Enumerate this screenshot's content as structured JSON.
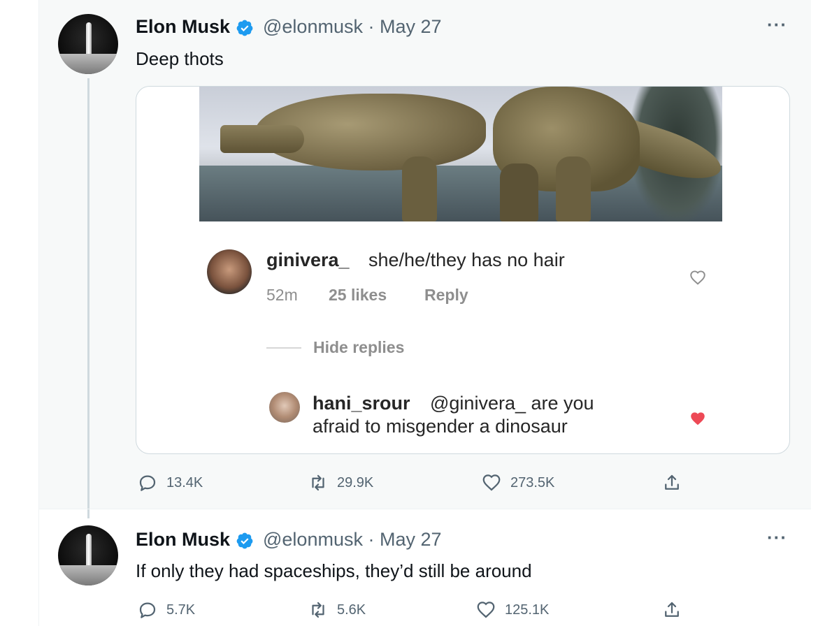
{
  "tweets": [
    {
      "name": "Elon Musk",
      "handle": "@elonmusk · May 27",
      "text": "Deep thots",
      "more": "···",
      "media": {
        "comment1": {
          "user": "ginivera_",
          "text": "she/he/they has no hair",
          "time": "52m",
          "likes": "25 likes",
          "reply": "Reply"
        },
        "hide_replies": "Hide replies",
        "comment2": {
          "user": "hani_srour",
          "text_line1": "@ginivera_ are you",
          "text_line2": "afraid to misgender a dinosaur"
        }
      },
      "actions": {
        "replies": "13.4K",
        "retweets": "29.9K",
        "likes": "273.5K"
      }
    },
    {
      "name": "Elon Musk",
      "handle": "@elonmusk · May 27",
      "text": "If only they had spaceships, they’d still be around",
      "more": "···",
      "actions": {
        "replies": "5.7K",
        "retweets": "5.6K",
        "likes": "125.1K"
      }
    }
  ],
  "colors": {
    "verified": "#1d9bf0",
    "secondary_text": "#536471",
    "ig_like_red": "#ed4956"
  }
}
